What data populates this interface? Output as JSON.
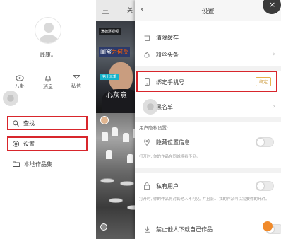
{
  "drawer": {
    "username": "贱康。",
    "quick_links": [
      {
        "label": "八卦",
        "icon": "eye-icon"
      },
      {
        "label": "消息",
        "icon": "bell-icon"
      },
      {
        "label": "私信",
        "icon": "mail-icon"
      }
    ],
    "menu": [
      {
        "label": "查找",
        "icon": "search-icon",
        "highlighted": true
      },
      {
        "label": "设置",
        "icon": "gear-icon",
        "highlighted": true
      },
      {
        "label": "本地作品集",
        "icon": "folder-icon",
        "highlighted": false
      }
    ]
  },
  "video": {
    "menu_glyph": "三",
    "top_cut_text": "关",
    "tag1": "满德逐视频",
    "caption1_white": "闺蜜",
    "caption1_orange": "为何反",
    "tag2": "第十三季",
    "caption2": "心灰意"
  },
  "settings": {
    "back_glyph": "‹",
    "title": "设置",
    "rows": {
      "clear_cache": "清除缓存",
      "fans_headline": "粉丝头条",
      "bind_phone": "绑定手机号",
      "bind_button": "绑定",
      "blacklist": "黑名单",
      "privacy_section": "用户隐私设置:",
      "hide_location": "隐藏位置信息",
      "hide_location_hint": "打开时, 你的作品在同城将看不见。",
      "private_user": "私有用户",
      "private_user_hint": "打开时, 你的作品将对其他人不可见, 并且会... 我的作品可以需要你的允许。",
      "disable_download": "禁止他人下载自己作品"
    },
    "corner_close_glyph": "×"
  },
  "colors": {
    "highlight_border": "#d8262c",
    "bind_accent": "#c99532"
  }
}
